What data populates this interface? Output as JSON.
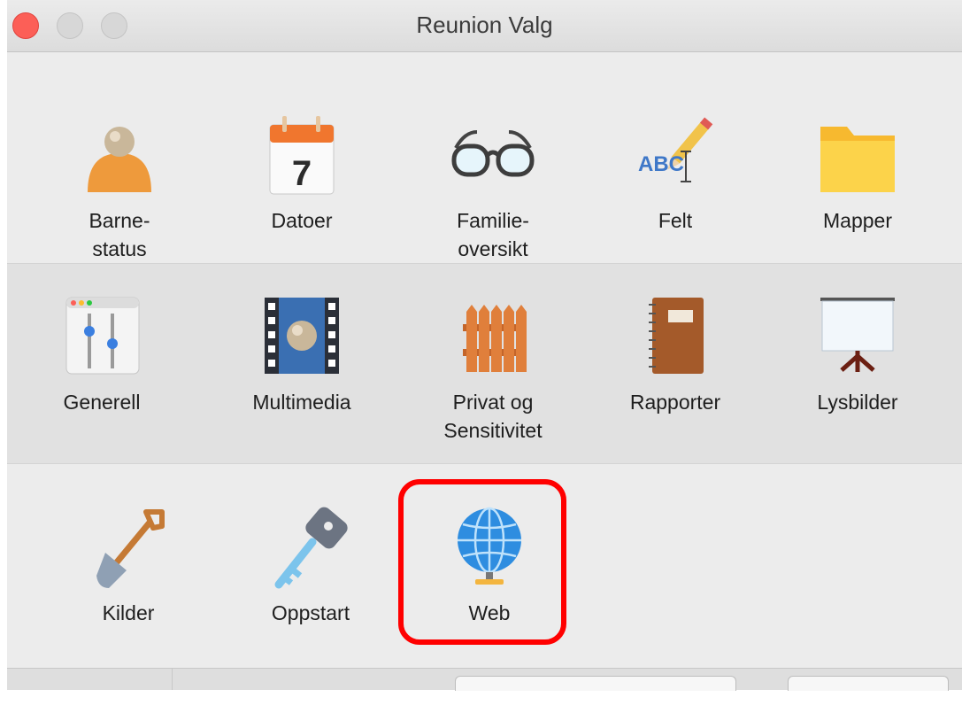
{
  "window": {
    "title": "Reunion Valg"
  },
  "rows": [
    {
      "items": [
        {
          "label": "Barne-\nstatus",
          "icon": "person-icon"
        },
        {
          "label": "Datoer",
          "icon": "calendar-icon",
          "day": "7"
        },
        {
          "label": "Familie-\noversikt",
          "icon": "glasses-icon"
        },
        {
          "label": "Felt",
          "icon": "field-pencil-icon",
          "glyph": "ABC"
        },
        {
          "label": "Mapper",
          "icon": "folder-icon"
        }
      ]
    },
    {
      "items": [
        {
          "label": "Generell",
          "icon": "sliders-icon"
        },
        {
          "label": "Multimedia",
          "icon": "filmstrip-icon"
        },
        {
          "label": "Privat og\nSensitivitet",
          "icon": "fence-icon"
        },
        {
          "label": "Rapporter",
          "icon": "notebook-icon"
        },
        {
          "label": "Lysbilder",
          "icon": "projector-screen-icon"
        }
      ]
    },
    {
      "items": [
        {
          "label": "Kilder",
          "icon": "shovel-icon"
        },
        {
          "label": "Oppstart",
          "icon": "key-icon"
        },
        {
          "label": "Web",
          "icon": "globe-icon"
        }
      ]
    }
  ],
  "selected": "Web",
  "colors": {
    "highlight": "#ff0000",
    "close_button": "#fc5f57"
  }
}
